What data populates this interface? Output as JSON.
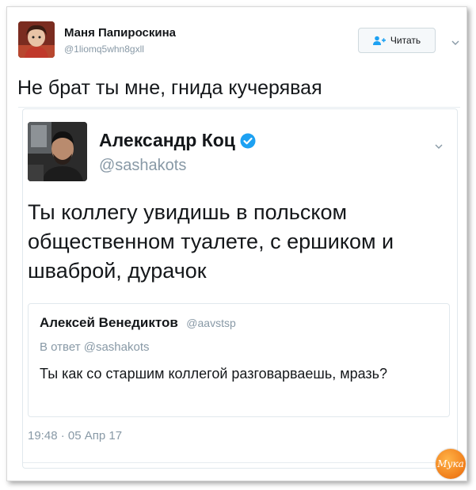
{
  "tweet": {
    "author_name": "Маня Папироскина",
    "author_handle": "@1liomq5whn8gxll",
    "follow_label": "Читать",
    "text": "Не брат ты мне, гнида кучерявая"
  },
  "embedded": {
    "author_name": "Александр Коц",
    "verified": true,
    "author_handle": "@sashakots",
    "text": "Ты коллегу увидишь в польском общественном туалете, с ершиком и шваброй, дурачок",
    "timestamp": "19:48 · 05 Апр 17",
    "quote": {
      "author_name": "Алексей Венедиктов",
      "author_handle": "@aavstsp",
      "reply_to": "В ответ @sashakots",
      "text": "Ты как со старшим коллегой разговарваешь, мразь?"
    }
  },
  "watermark": {
    "text": "Мука"
  },
  "colors": {
    "verified": "#1da1f2",
    "secondary_text": "#8899a6",
    "border": "#e1e8ed"
  },
  "icons": [
    "follow-user-icon",
    "chevron-down-icon",
    "verified-badge-icon"
  ]
}
